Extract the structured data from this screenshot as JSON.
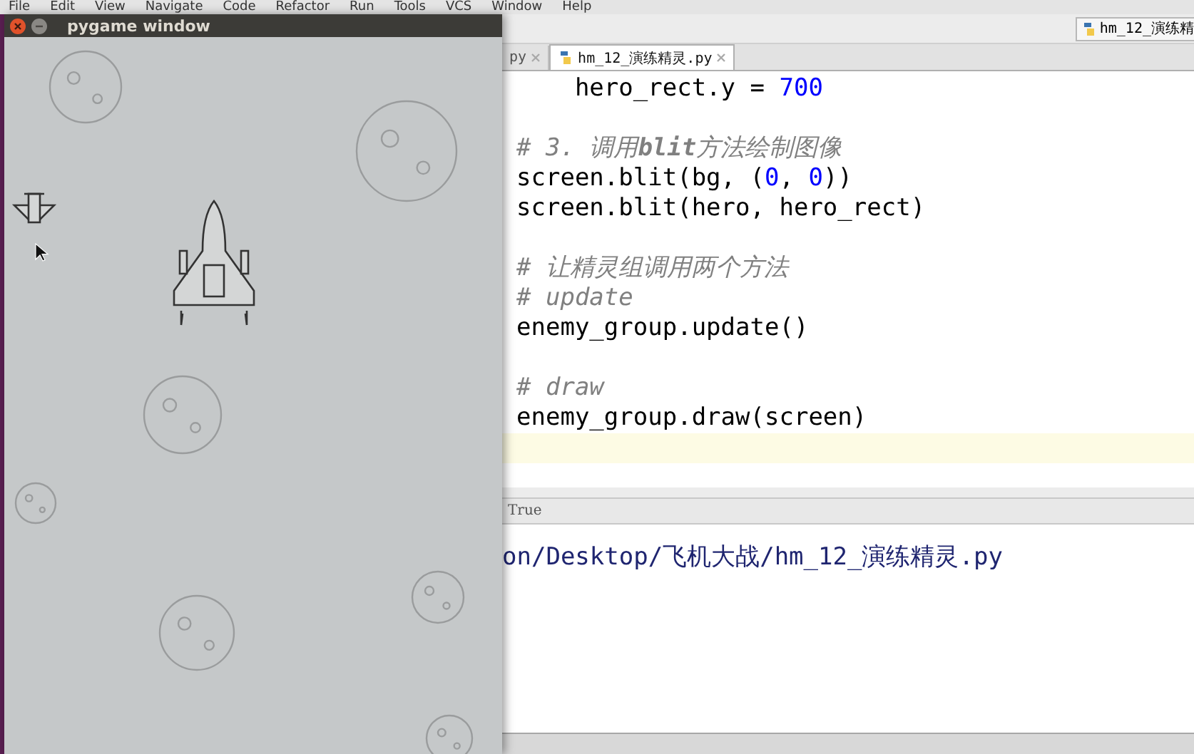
{
  "menu_bar": [
    "File",
    "Edit",
    "View",
    "Navigate",
    "Code",
    "Refactor",
    "Run",
    "Tools",
    "VCS",
    "Window",
    "Help"
  ],
  "game_window": {
    "title": "pygame window"
  },
  "ide": {
    "breadcrumb": "hm_12_演练精",
    "tabs": [
      {
        "label": "py",
        "selected": false
      },
      {
        "label": "hm_12_演练精灵.py",
        "selected": true
      }
    ],
    "code_lines": [
      {
        "kind": "code",
        "tokens": [
          {
            "kind": "plain",
            "text": "    hero_rect.y = "
          },
          {
            "kind": "number",
            "text": "700"
          }
        ]
      },
      {
        "kind": "blank"
      },
      {
        "kind": "code",
        "tokens": [
          {
            "kind": "comment",
            "text": "# 3. 调用**blit**方法绘制图像"
          }
        ]
      },
      {
        "kind": "code",
        "tokens": [
          {
            "kind": "plain",
            "text": "screen.blit(bg, ("
          },
          {
            "kind": "number",
            "text": "0"
          },
          {
            "kind": "plain",
            "text": ", "
          },
          {
            "kind": "number",
            "text": "0"
          },
          {
            "kind": "plain",
            "text": "))"
          }
        ]
      },
      {
        "kind": "code",
        "tokens": [
          {
            "kind": "plain",
            "text": "screen.blit(hero, hero_rect)"
          }
        ]
      },
      {
        "kind": "blank"
      },
      {
        "kind": "code",
        "tokens": [
          {
            "kind": "comment",
            "text": "# 让精灵组调用两个方法"
          }
        ]
      },
      {
        "kind": "code",
        "tokens": [
          {
            "kind": "comment",
            "text": "# update"
          }
        ]
      },
      {
        "kind": "code",
        "tokens": [
          {
            "kind": "plain",
            "text": "enemy_group.update()"
          }
        ]
      },
      {
        "kind": "blank"
      },
      {
        "kind": "code",
        "tokens": [
          {
            "kind": "comment",
            "text": "# draw"
          }
        ]
      },
      {
        "kind": "code",
        "tokens": [
          {
            "kind": "plain",
            "text": "enemy_group.draw(screen)"
          }
        ]
      },
      {
        "kind": "highlighted"
      }
    ],
    "console_header": "True",
    "console_lines": [
      "on/Desktop/飞机大战/hm_12_演练精灵.py"
    ]
  }
}
